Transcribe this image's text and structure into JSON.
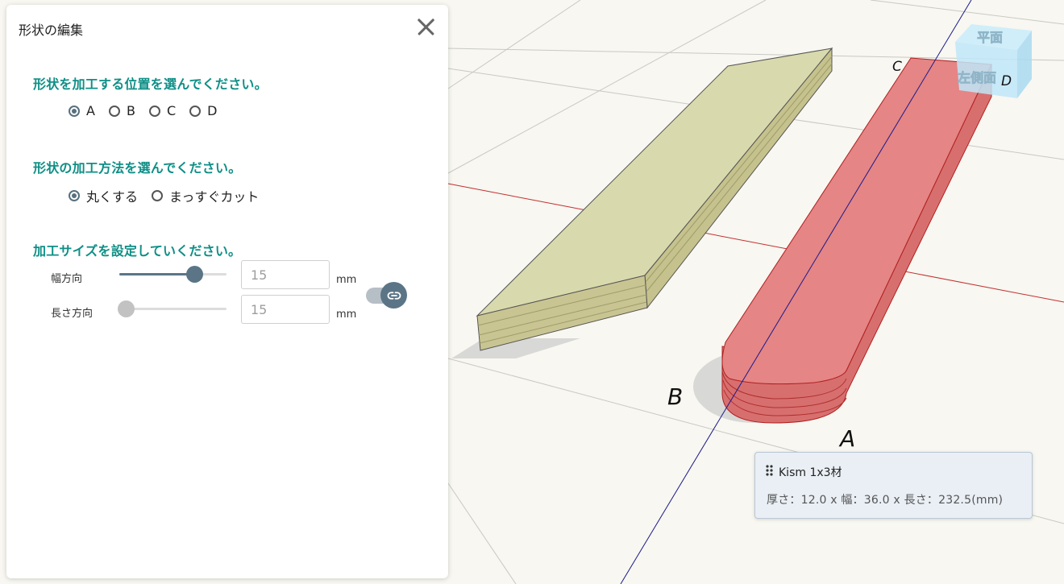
{
  "panel": {
    "title": "形状の編集",
    "position_section": {
      "title": "形状を加工する位置を選んでください。",
      "options": [
        "A",
        "B",
        "C",
        "D"
      ],
      "selected": "A"
    },
    "method_section": {
      "title": "形状の加工方法を選んでください。",
      "options": [
        "丸くする",
        "まっすぐカット"
      ],
      "selected": "丸くする"
    },
    "size_section": {
      "title": "加工サイズを設定していください。",
      "width": {
        "label": "幅方向",
        "value": "15",
        "unit": "mm",
        "slider_fraction": 0.73
      },
      "length": {
        "label": "長さ方向",
        "value": "15",
        "unit": "mm",
        "slider_fraction": 0.0
      }
    },
    "link_toggle": {
      "on": true
    }
  },
  "viewport": {
    "corner_labels": {
      "a": "A",
      "b": "B",
      "c": "C",
      "d": "D"
    },
    "view_cube": {
      "top": "平面",
      "left": "左側面"
    },
    "info_box": {
      "title": "Kism 1x3材",
      "dimensions": "厚さ：12.0 x 幅：36.0 x 長さ：232.5(mm)"
    }
  },
  "colors": {
    "accent": "#0e8f86",
    "control": "#5b7587",
    "board_top": "#d8d9ad",
    "board_side": "#c9c593",
    "selected_board": "#e58585",
    "axis_blue": "#1a1a8c",
    "axis_red": "#c23030"
  }
}
